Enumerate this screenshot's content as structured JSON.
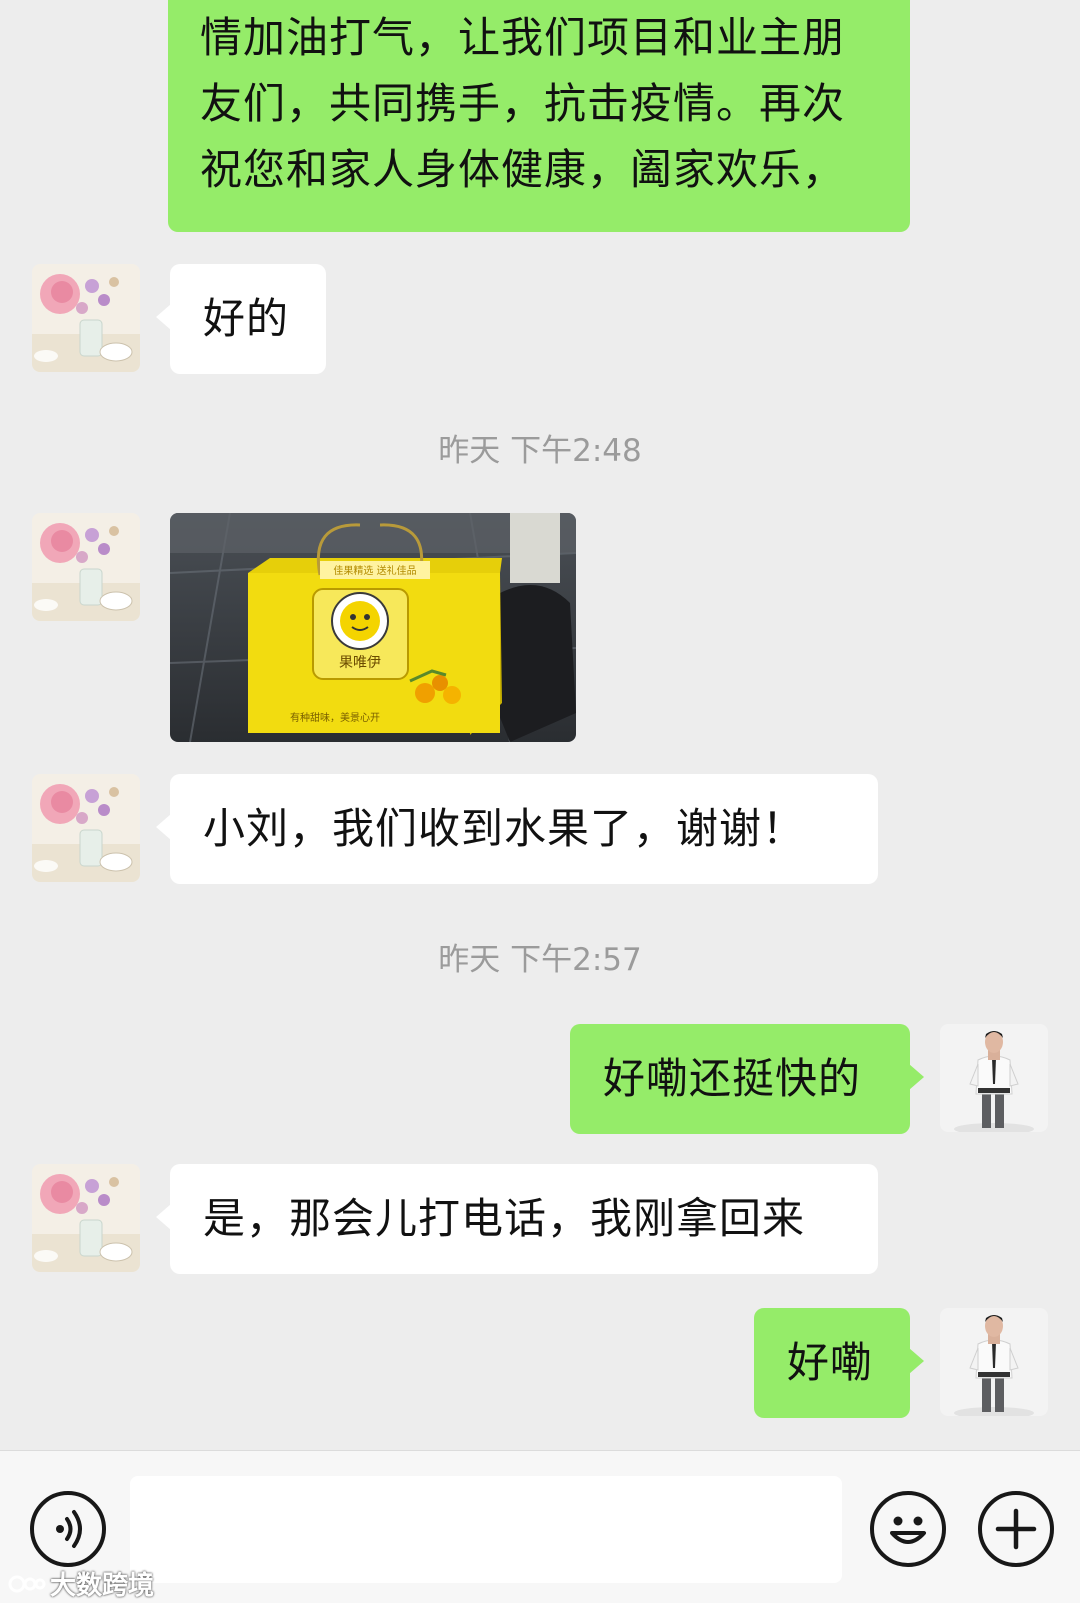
{
  "messages": {
    "m1_line1": "情加油打气，让我们项目和业主朋",
    "m1_line2": "友们，共同携手，抗击疫情。再次",
    "m1_line3": "祝您和家人身体健康，阖家欢乐，",
    "m2": "好的",
    "ts1": "昨天 下午2:48",
    "m4": "小刘，我们收到水果了，谢谢！",
    "ts2": "昨天 下午2:57",
    "m5": "好嘞还挺快的",
    "m6": "是，那会儿打电话，我刚拿回来",
    "m7": "好嘞"
  },
  "photo": {
    "box_text": "果唯伊",
    "box_top_text": "佳果精选 送礼佳品",
    "box_bottom_text": "有种甜味，美景心开"
  },
  "input_bar": {
    "placeholder": ""
  },
  "watermark": {
    "text": "大数跨境"
  },
  "colors": {
    "outgoing_bubble": "#95ec69",
    "incoming_bubble": "#ffffff",
    "background": "#ededed",
    "timestamp": "#9b9b9b"
  },
  "icons": {
    "voice": "voice-icon",
    "emoji": "emoji-icon",
    "more": "plus-icon"
  }
}
